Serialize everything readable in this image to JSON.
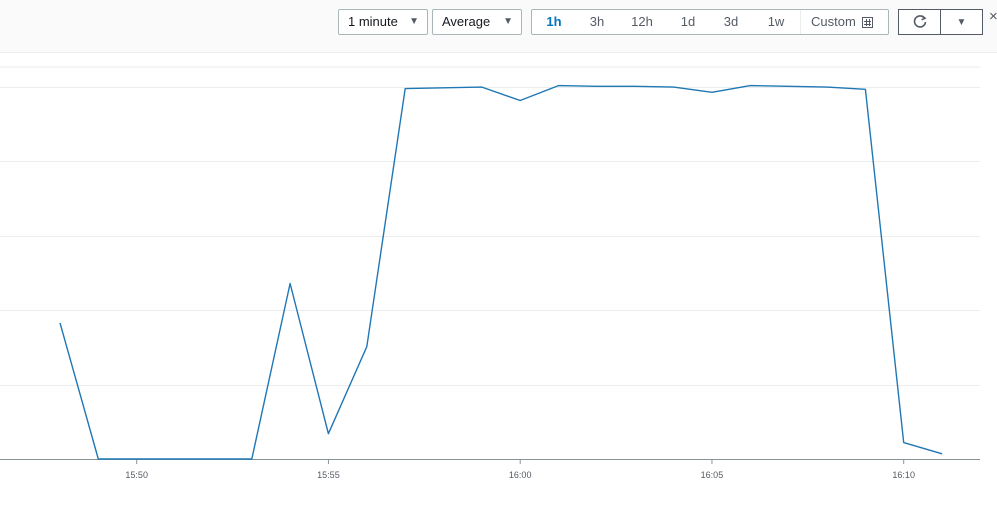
{
  "toolbar": {
    "period_label": "1 minute",
    "statistic_label": "Average",
    "ranges": [
      {
        "label": "1h",
        "active": true
      },
      {
        "label": "3h",
        "active": false
      },
      {
        "label": "12h",
        "active": false
      },
      {
        "label": "1d",
        "active": false
      },
      {
        "label": "3d",
        "active": false
      },
      {
        "label": "1w",
        "active": false
      }
    ],
    "custom_label": "Custom",
    "close_glyph": "×",
    "icons": {
      "calendar": "calendar-icon",
      "refresh": "refresh-icon",
      "dropdown": "caret-down-icon",
      "close": "close-icon"
    }
  },
  "chart_data": {
    "type": "line",
    "x_unit": "time (minutes)",
    "x_tick_labels": [
      "15:50",
      "15:55",
      "16:00",
      "16:05",
      "16:10"
    ],
    "series": [
      {
        "color": "#1f77b4",
        "points": [
          [
            "15:48",
            1.83
          ],
          [
            "15:49",
            0.0
          ],
          [
            "15:50",
            0.0
          ],
          [
            "15:51",
            0.0
          ],
          [
            "15:52",
            0.0
          ],
          [
            "15:53",
            0.0
          ],
          [
            "15:54",
            2.36
          ],
          [
            "15:55",
            0.34
          ],
          [
            "15:56",
            1.51
          ],
          [
            "15:57",
            4.98
          ],
          [
            "15:58",
            4.99
          ],
          [
            "15:59",
            5.0
          ],
          [
            "16:00",
            4.82
          ],
          [
            "16:01",
            5.02
          ],
          [
            "16:02",
            5.01
          ],
          [
            "16:03",
            5.01
          ],
          [
            "16:04",
            5.0
          ],
          [
            "16:05",
            4.93
          ],
          [
            "16:06",
            5.02
          ],
          [
            "16:07",
            5.01
          ],
          [
            "16:08",
            5.0
          ],
          [
            "16:09",
            4.97
          ],
          [
            "16:10",
            0.22
          ],
          [
            "16:11",
            0.07
          ]
        ]
      }
    ],
    "ylim": [
      0,
      5.27
    ],
    "y_gridlines": [
      1,
      2,
      3,
      4,
      5
    ],
    "grid": true
  }
}
